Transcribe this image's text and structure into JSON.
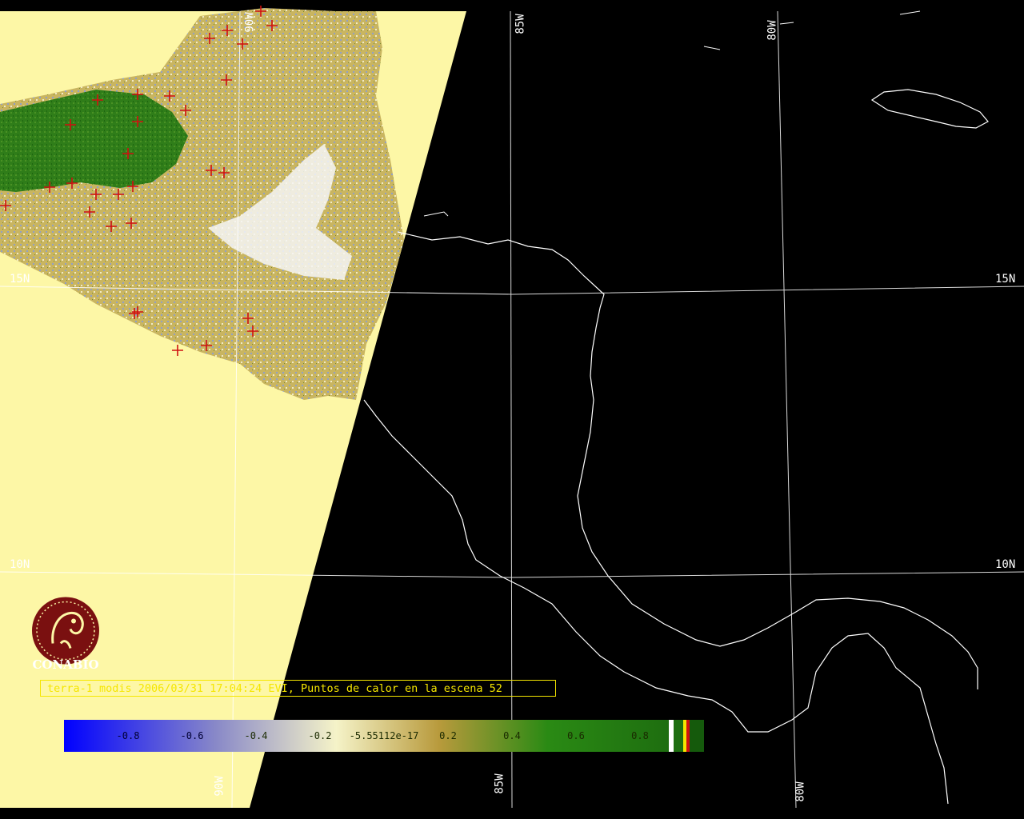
{
  "caption": "terra-1 modis 2006/03/31 17:04:24 EVI, Puntos de calor en la escena 52",
  "logo": {
    "text": "CONABIO",
    "icon": "conabio-logo-icon",
    "color": "#7a1010"
  },
  "grid_labels": {
    "lon_85w_top": "85W",
    "lon_80w_top": "80W",
    "lon_90w_top": "90W",
    "lon_85w_bottom": "85W",
    "lon_80w_bottom": "80W",
    "lon_90w_bottom": "90W",
    "lat_15n_left": "15N",
    "lat_15n_right": "15N",
    "lat_10n_left": "10N",
    "lat_10n_right": "10N"
  },
  "colorbar": {
    "ticks": [
      "-0.8",
      "-0.6",
      "-0.4",
      "-0.2",
      "-5.55112e-17",
      "0.2",
      "0.4",
      "0.6",
      "0.8"
    ],
    "colors": {
      "low": "#0000ff",
      "mid": "#f5f3c8",
      "neutral": "#b89a3c",
      "high": "#1e6e10",
      "swath": "#fdf7a6",
      "hotspot": "#d01010",
      "coast": "#ffffff"
    }
  },
  "legend_swatches": [
    "white",
    "yellow",
    "red",
    "green"
  ]
}
